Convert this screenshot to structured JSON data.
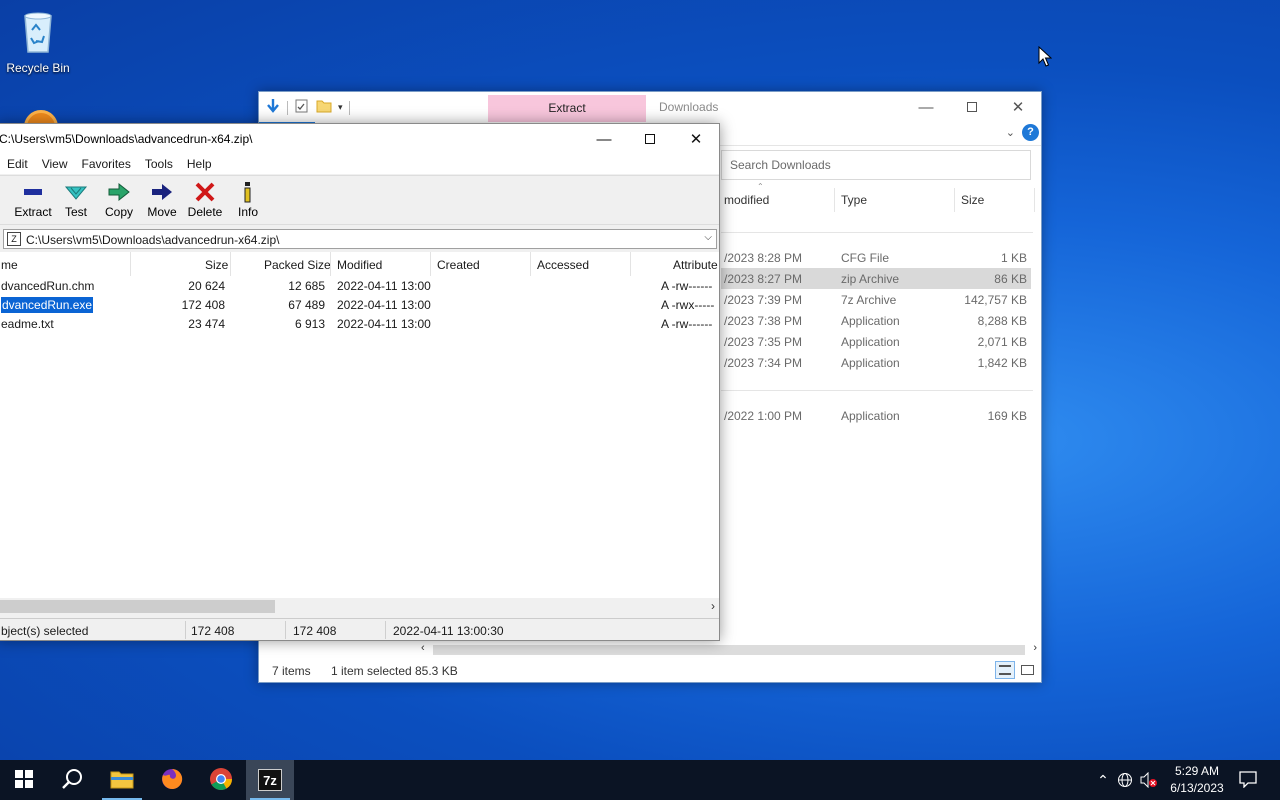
{
  "desktop": {
    "icons": [
      {
        "label": "Recycle Bin",
        "icon": "recycle-bin-icon"
      }
    ]
  },
  "explorer": {
    "title": "Downloads",
    "context_tab": "Extract",
    "search_placeholder": "Search Downloads",
    "columns": [
      "modified",
      "Type",
      "Size"
    ],
    "rows": [
      {
        "date": "/2023 8:28 PM",
        "type": "CFG File",
        "size": "1 KB",
        "selected": false
      },
      {
        "date": "/2023 8:27 PM",
        "type": "zip Archive",
        "size": "86 KB",
        "selected": true
      },
      {
        "date": "/2023 7:39 PM",
        "type": "7z Archive",
        "size": "142,757 KB",
        "selected": false
      },
      {
        "date": "/2023 7:38 PM",
        "type": "Application",
        "size": "8,288 KB",
        "selected": false
      },
      {
        "date": "/2023 7:35 PM",
        "type": "Application",
        "size": "2,071 KB",
        "selected": false
      },
      {
        "date": "/2023 7:34 PM",
        "type": "Application",
        "size": "1,842 KB",
        "selected": false
      }
    ],
    "rows_older": [
      {
        "date": "/2022 1:00 PM",
        "type": "Application",
        "size": "169 KB"
      }
    ],
    "status": {
      "items": "7 items",
      "selected": "1 item selected",
      "selected_size": "85.3 KB"
    }
  },
  "zip": {
    "title": "C:\\Users\\vm5\\Downloads\\advancedrun-x64.zip\\",
    "menu": [
      "Edit",
      "View",
      "Favorites",
      "Tools",
      "Help"
    ],
    "toolbar": [
      {
        "label": "Extract",
        "icon": "extract-icon",
        "color": "#1f2f9e"
      },
      {
        "label": "Test",
        "icon": "test-icon",
        "color": "#25a7a7"
      },
      {
        "label": "Copy",
        "icon": "copy-icon",
        "color": "#1f8a55"
      },
      {
        "label": "Move",
        "icon": "move-icon",
        "color": "#1a237e"
      },
      {
        "label": "Delete",
        "icon": "delete-icon",
        "color": "#d01818"
      },
      {
        "label": "Info",
        "icon": "info-icon",
        "color": "#a08a10"
      }
    ],
    "address": "C:\\Users\\vm5\\Downloads\\advancedrun-x64.zip\\",
    "columns": [
      "me",
      "Size",
      "Packed Size",
      "Modified",
      "Created",
      "Accessed",
      "Attribute"
    ],
    "files": [
      {
        "name": "dvancedRun.chm",
        "size": "20 624",
        "packed": "12 685",
        "modified": "2022-04-11 13:00",
        "attr": "A -rw------",
        "selected": false
      },
      {
        "name": "dvancedRun.exe",
        "size": "172 408",
        "packed": "67 489",
        "modified": "2022-04-11 13:00",
        "attr": "A -rwx-----",
        "selected": true
      },
      {
        "name": "eadme.txt",
        "size": "23 474",
        "packed": "6 913",
        "modified": "2022-04-11 13:00",
        "attr": "A -rw------",
        "selected": false
      }
    ],
    "status": {
      "selected": "bject(s) selected",
      "size": "172 408",
      "packed": "172 408",
      "modified": "2022-04-11 13:00:30"
    }
  },
  "taskbar": {
    "items": [
      {
        "name": "start",
        "icon": "windows-start-icon"
      },
      {
        "name": "search",
        "icon": "search-icon"
      },
      {
        "name": "file-explorer",
        "icon": "folder-icon"
      },
      {
        "name": "firefox",
        "icon": "firefox-icon"
      },
      {
        "name": "chrome",
        "icon": "chrome-icon"
      },
      {
        "name": "7zip",
        "icon": "7zip-icon",
        "label": "7z"
      }
    ],
    "time": "5:29 AM",
    "date": "6/13/2023"
  }
}
